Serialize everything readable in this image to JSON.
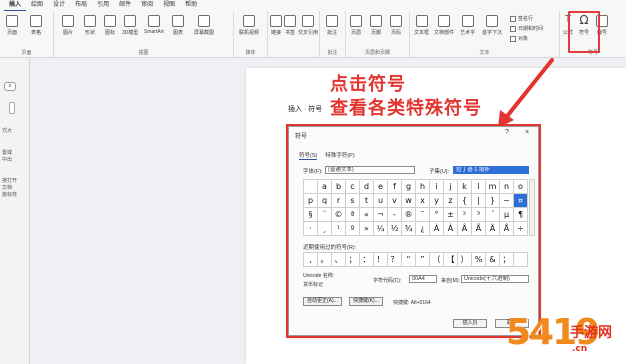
{
  "ribbon": {
    "tabs": [
      "插入",
      "绘图",
      "设计",
      "布局",
      "引用",
      "邮件",
      "审阅",
      "视图",
      "帮助"
    ],
    "groups": {
      "pages": {
        "label": "页面",
        "buttons": [
          "页面",
          "表格"
        ]
      },
      "illustrations": {
        "label": "插图",
        "buttons": [
          "图片",
          "形状",
          "图标",
          "3D模型",
          "SmartArt",
          "图表",
          "屏幕截图"
        ]
      },
      "media": {
        "label": "媒体",
        "buttons": [
          "联机视频"
        ]
      },
      "links": {
        "label": "",
        "buttons": [
          "链接",
          "书签",
          "交叉引用"
        ]
      },
      "comments": {
        "label": "批注",
        "buttons": [
          "批注"
        ]
      },
      "header_footer": {
        "label": "页眉和页脚",
        "buttons": [
          "页眉",
          "页脚",
          "页码"
        ]
      },
      "text": {
        "label": "文本",
        "buttons": [
          "文本框",
          "文档部件",
          "艺术字",
          "首字下沉"
        ],
        "small": [
          "签名行",
          "日期和时间",
          "对象"
        ]
      },
      "symbols": {
        "label": "符号",
        "buttons": [
          "公式",
          "符号",
          "编号"
        ]
      }
    }
  },
  "left_pane": {
    "search_icon": "⌕",
    "lines": [
      "式大",
      "置或",
      "中出",
      "",
      "按打开",
      "文档",
      "篇标样"
    ]
  },
  "document": {
    "line": "插入 · 符号"
  },
  "annotations": {
    "line1": "点击符号",
    "line2": "查看各类特殊符号",
    "color": "#e3342f"
  },
  "dialog": {
    "title": "符号",
    "tabs": [
      "符号(S)",
      "特殊字符(P)"
    ],
    "font_label": "字体(F):",
    "font_value": "(普通文本)",
    "subset_label": "子集(U):",
    "subset_value": "拉丁语-1 增补",
    "symbols": [
      [
        "",
        "a",
        "b",
        "c",
        "d",
        "e",
        "f",
        "g",
        "h",
        "i",
        "j",
        "k",
        "l",
        "m",
        "n",
        "o"
      ],
      [
        "p",
        "q",
        "r",
        "s",
        "t",
        "u",
        "v",
        "w",
        "x",
        "y",
        "z",
        "{",
        "|",
        "}",
        "~",
        "¤"
      ],
      [
        "§",
        "¨",
        "©",
        "ª",
        "«",
        "¬",
        "-",
        "®",
        "¯",
        "°",
        "±",
        "²",
        "³",
        "´",
        "µ",
        "¶"
      ],
      [
        "·",
        "¸",
        "¹",
        "º",
        "»",
        "¼",
        "½",
        "¾",
        "¿",
        "À",
        "Á",
        "Â",
        "Ã",
        "Ä",
        "Å",
        "÷"
      ]
    ],
    "selected_symbol": "¤",
    "recent_label": "近期使用过的符号(R):",
    "recent": [
      ",",
      "。",
      "、",
      "；",
      "：",
      "！",
      "？",
      "“",
      "”",
      "（",
      "【",
      "）",
      "%",
      "&",
      "；",
      ""
    ],
    "unicode_name_label": "Unicode 名称:",
    "unicode_name": "货币标记",
    "char_code_label": "字符代码(C):",
    "char_code": "00A4",
    "from_label": "来自(M):",
    "from_value": "Unicode(十六进制)",
    "autocorrect_button": "自动更正(A)...",
    "shortcut_button": "快捷键(K)...",
    "shortcut_text": "快捷键: Alt+0164",
    "insert_button": "插入(I)",
    "cancel_button": "取消"
  },
  "watermark": {
    "big": "5419",
    "cn": "手游网",
    "url": ".cn",
    "color": "#f08a1c"
  }
}
